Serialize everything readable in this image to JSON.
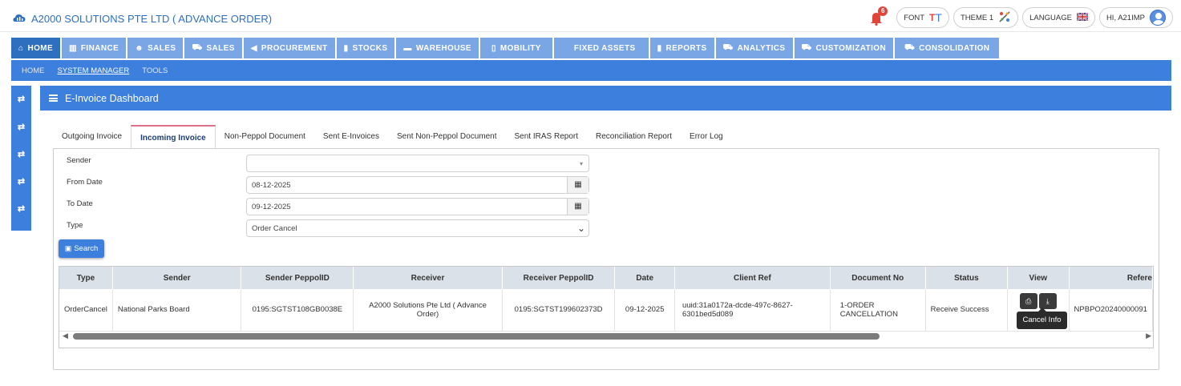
{
  "header": {
    "company": "A2000 SOLUTIONS PTE LTD ( ADVANCE ORDER)",
    "notifications_count": "6",
    "font_label": "FONT",
    "theme_label": "THEME 1",
    "language_label": "LANGUAGE",
    "user_label": "HI, A21IMP"
  },
  "menu": [
    {
      "label": "HOME",
      "icon": "home-icon"
    },
    {
      "label": "FINANCE",
      "icon": "bank-icon"
    },
    {
      "label": "SALES",
      "icon": "users-icon"
    },
    {
      "label": "SALES",
      "icon": "cart-icon"
    },
    {
      "label": "PROCUREMENT",
      "icon": "bullhorn-icon"
    },
    {
      "label": "STOCKS",
      "icon": "bar-chart-icon"
    },
    {
      "label": "WAREHOUSE",
      "icon": "warehouse-icon"
    },
    {
      "label": "MOBILITY",
      "icon": "mobile-icon"
    },
    {
      "label": "FIXED ASSETS",
      "icon": "none"
    },
    {
      "label": "REPORTS",
      "icon": "bar-chart-icon"
    },
    {
      "label": "ANALYTICS",
      "icon": "cart-icon"
    },
    {
      "label": "CUSTOMIZATION",
      "icon": "cart-icon"
    },
    {
      "label": "CONSOLIDATION",
      "icon": "cart-icon"
    }
  ],
  "submenu": [
    "HOME",
    "SYSTEM MANAGER",
    "TOOLS"
  ],
  "panel_title": "E-Invoice Dashboard",
  "tabs": [
    "Outgoing Invoice",
    "Incoming Invoice",
    "Non-Peppol Document",
    "Sent E-Invoices",
    "Sent Non-Peppol Document",
    "Sent IRAS Report",
    "Reconciliation Report",
    "Error Log"
  ],
  "form": {
    "sender_label": "Sender",
    "sender_value": "",
    "from_label": "From Date",
    "from_value": "08-12-2025",
    "to_label": "To Date",
    "to_value": "09-12-2025",
    "type_label": "Type",
    "type_value": "Order Cancel",
    "search_label": "Search"
  },
  "table": {
    "columns": [
      "Type",
      "Sender",
      "Sender PeppolID",
      "Receiver",
      "Receiver PeppolID",
      "Date",
      "Client Ref",
      "Document No",
      "Status",
      "View",
      "Refere"
    ],
    "rows": [
      {
        "type": "OrderCancel",
        "sender": "National Parks Board",
        "sender_peppol": "0195:SGTST108GB0038E",
        "receiver": "A2000 Solutions Pte Ltd ( Advance Order)",
        "receiver_peppol": "0195:SGTST199602373D",
        "date": "09-12-2025",
        "client_ref": "uuid:31a0172a-dcde-497c-8627-6301bed5d089",
        "document_no": "1-ORDER CANCELLATION",
        "status": "Receive Success",
        "reference": "NPBPO20240000091"
      }
    ]
  },
  "tooltip": "Cancel Info",
  "colors": {
    "primary": "#3d7fdc",
    "menu": "#7aa6e6",
    "active_tab": "#e0708a"
  }
}
